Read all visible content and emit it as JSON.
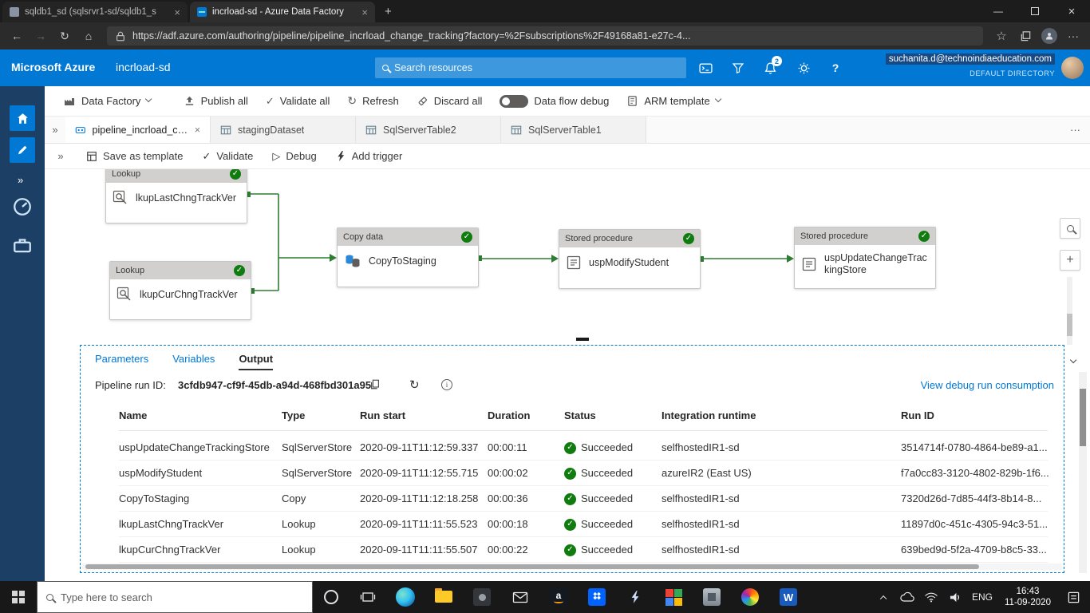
{
  "browser": {
    "tabs": [
      {
        "title": "sqldb1_sd (sqlsrvr1-sd/sqldb1_s",
        "active": false
      },
      {
        "title": "incrload-sd - Azure Data Factory",
        "active": true
      }
    ],
    "url": "https://adf.azure.com/authoring/pipeline/pipeline_incrload_change_tracking?factory=%2Fsubscriptions%2F49168a81-e27c-4..."
  },
  "azure_bar": {
    "brand": "Microsoft Azure",
    "factory_name": "incrload-sd",
    "search_placeholder": "Search resources",
    "notification_count": "2",
    "user_email": "suchanita.d@technoindiaeducation.com",
    "directory": "DEFAULT DIRECTORY"
  },
  "command_bar": {
    "data_factory_label": "Data Factory",
    "publish_all_label": "Publish all",
    "validate_all_label": "Validate all",
    "refresh_label": "Refresh",
    "discard_all_label": "Discard all",
    "data_flow_debug_label": "Data flow debug",
    "arm_template_label": "ARM template"
  },
  "resource_tabs": {
    "tabs": [
      {
        "label": "pipeline_incrload_ch..."
      },
      {
        "label": "stagingDataset"
      },
      {
        "label": "SqlServerTable2"
      },
      {
        "label": "SqlServerTable1"
      }
    ]
  },
  "pipeline_bar": {
    "save_as_template_label": "Save as template",
    "validate_label": "Validate",
    "debug_label": "Debug",
    "add_trigger_label": "Add trigger"
  },
  "canvas": {
    "nodes": [
      {
        "type": "Lookup",
        "name": "lkupLastChngTrackVer"
      },
      {
        "type": "Lookup",
        "name": "lkupCurChngTrackVer"
      },
      {
        "type": "Copy data",
        "name": "CopyToStaging"
      },
      {
        "type": "Stored procedure",
        "name": "uspModifyStudent"
      },
      {
        "type": "Stored procedure",
        "name": "uspUpdateChangeTrackingStore"
      }
    ]
  },
  "output": {
    "tabs": {
      "parameters": "Parameters",
      "variables": "Variables",
      "output": "Output"
    },
    "run_id_label": "Pipeline run ID:",
    "run_id": "3cfdb947-cf9f-45db-a94d-468fbd301a95",
    "view_link": "View debug run consumption",
    "table": {
      "headers": [
        "Name",
        "Type",
        "Run start",
        "Duration",
        "Status",
        "Integration runtime",
        "Run ID"
      ],
      "rows": [
        {
          "name": "uspUpdateChangeTrackingStore",
          "type": "SqlServerStore",
          "run_start": "2020-09-11T11:12:59.337",
          "duration": "00:00:11",
          "status": "Succeeded",
          "ir": "selfhostedIR1-sd",
          "run_id": "3514714f-0780-4864-be89-a1..."
        },
        {
          "name": "uspModifyStudent",
          "type": "SqlServerStore",
          "run_start": "2020-09-11T11:12:55.715",
          "duration": "00:00:02",
          "status": "Succeeded",
          "ir": "azureIR2 (East US)",
          "run_id": "f7a0cc83-3120-4802-829b-1f6..."
        },
        {
          "name": "CopyToStaging",
          "type": "Copy",
          "run_start": "2020-09-11T11:12:18.258",
          "duration": "00:00:36",
          "status": "Succeeded",
          "ir": "selfhostedIR1-sd",
          "run_id": "7320d26d-7d85-44f3-8b14-8..."
        },
        {
          "name": "lkupLastChngTrackVer",
          "type": "Lookup",
          "run_start": "2020-09-11T11:11:55.523",
          "duration": "00:00:18",
          "status": "Succeeded",
          "ir": "selfhostedIR1-sd",
          "run_id": "11897d0c-451c-4305-94c3-51..."
        },
        {
          "name": "lkupCurChngTrackVer",
          "type": "Lookup",
          "run_start": "2020-09-11T11:11:55.507",
          "duration": "00:00:22",
          "status": "Succeeded",
          "ir": "selfhostedIR1-sd",
          "run_id": "639bed9d-5f2a-4709-b8c5-33..."
        }
      ]
    }
  },
  "taskbar": {
    "search_placeholder": "Type here to search",
    "language": "ENG",
    "time": "16:43",
    "date": "11-09-2020"
  },
  "icons": {
    "back": "←",
    "forward": "→",
    "refresh": "↻",
    "home": "⌂",
    "favorites": "☆",
    "minimize": "—",
    "close": "×",
    "new_tab": "+",
    "ellipsis": "···",
    "double_chevron_right": "»",
    "double_chevron_left": "«",
    "check": "✓",
    "play": "▷",
    "braces": "{}",
    "help": "?",
    "zoom_in": "+",
    "word_w": "W",
    "amazon_a": "a"
  },
  "colors": {
    "azure_blue": "#0078d4",
    "success_green": "#107c10",
    "connector_green": "#2e7d32",
    "sidenav_navy": "#1c3f66"
  }
}
